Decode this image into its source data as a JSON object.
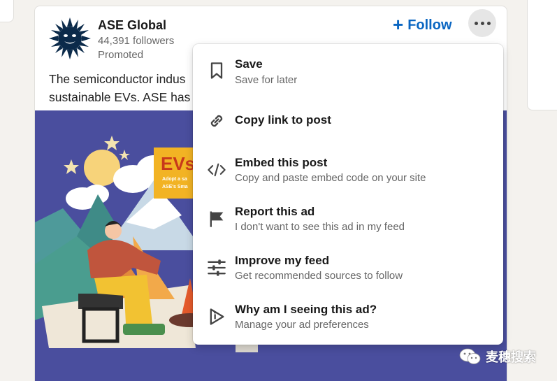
{
  "post": {
    "company_name": "ASE Global",
    "followers": "44,391 followers",
    "promoted": "Promoted",
    "follow_label": "Follow",
    "follow_plus": "+",
    "text_line1": "The semiconductor indus",
    "text_line2": "sustainable EVs. ASE has"
  },
  "banner": {
    "headline": "EVs",
    "sub_line1": "Adopt a sa",
    "sub_line2": "ASE's Sma"
  },
  "menu": {
    "items": [
      {
        "title": "Save",
        "subtitle": "Save for later",
        "icon": "bookmark-icon"
      },
      {
        "title": "Copy link to post",
        "subtitle": "",
        "icon": "link-icon"
      },
      {
        "title": "Embed this post",
        "subtitle": "Copy and paste embed code on your site",
        "icon": "code-icon"
      },
      {
        "title": "Report this ad",
        "subtitle": "I don't want to see this ad in my feed",
        "icon": "flag-icon"
      },
      {
        "title": "Improve my feed",
        "subtitle": "Get recommended sources to follow",
        "icon": "sliders-icon"
      },
      {
        "title": "Why am I seeing this ad?",
        "subtitle": "Manage your ad preferences",
        "icon": "play-info-icon"
      }
    ]
  },
  "watermark": {
    "text": "麦穗搜索",
    "icon": "wechat-icon"
  },
  "colors": {
    "brand_blue": "#0a66c2",
    "banner_bg": "#4a4e9e",
    "page_bg": "#f4f2ee"
  }
}
